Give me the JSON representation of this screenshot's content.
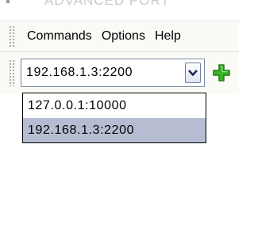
{
  "window": {
    "title_partial": "ADVANCED PORT"
  },
  "menubar": {
    "items": [
      "Commands",
      "Options",
      "Help"
    ]
  },
  "toolbar": {
    "address_value": "192.168.1.3:2200",
    "add_icon": "plus-icon",
    "dropdown_arrow_icon": "chevron-down-icon"
  },
  "dropdown": {
    "options": [
      "127.0.0.1:10000",
      "192.168.1.3:2200"
    ],
    "selected_index": 1
  },
  "colors": {
    "selection": "#b6bdd2",
    "add_icon": "#3bb42a",
    "combo_border": "#7a8aa8"
  }
}
